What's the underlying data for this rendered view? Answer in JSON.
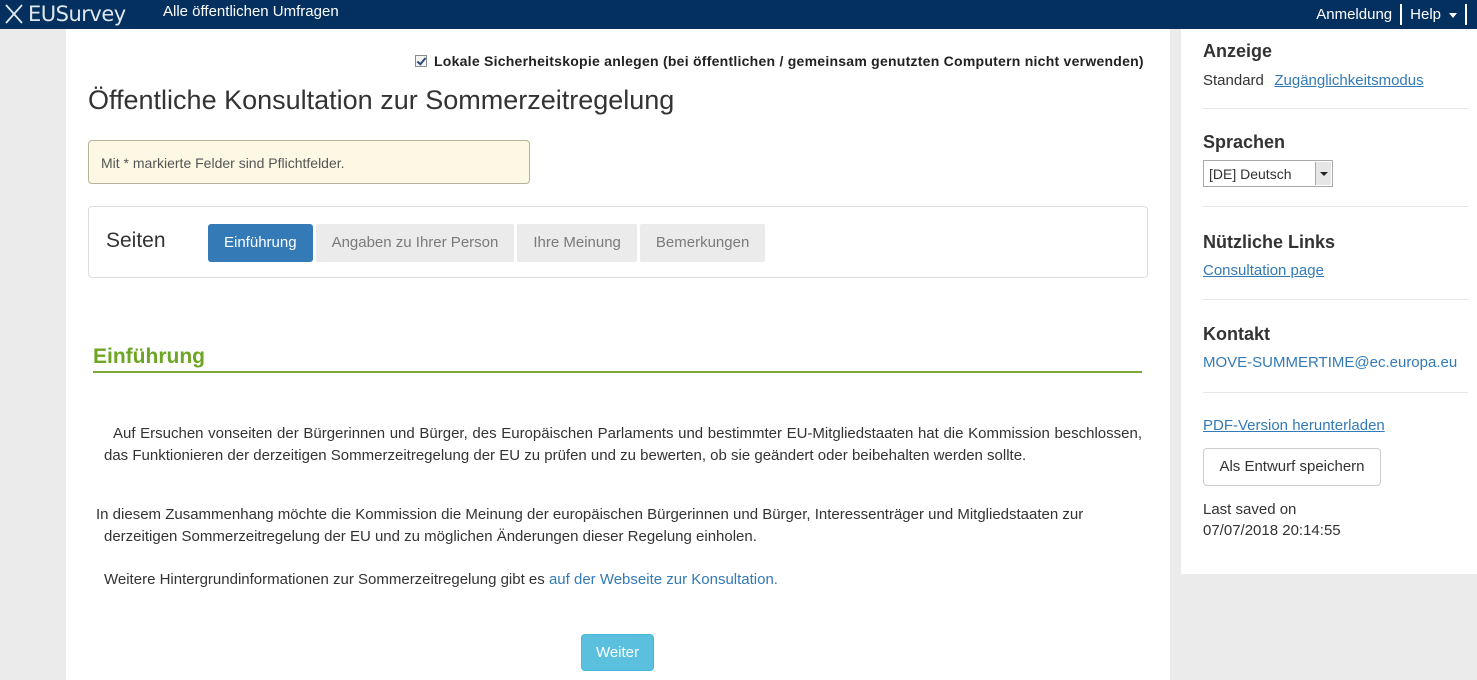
{
  "topbar": {
    "logo_text": "EUSurvey",
    "public_surveys": "Alle öffentlichen Umfragen",
    "login": "Anmeldung",
    "help": "Help"
  },
  "main": {
    "backup_label": "Lokale Sicherheitskopie anlegen (bei öffentlichen / gemeinsam genutzten Computern nicht verwenden)",
    "backup_checked": true,
    "title": "Öffentliche Konsultation zur Sommerzeitregelung",
    "required_notice": "Mit * markierte Felder sind Pflichtfelder.",
    "pages_label": "Seiten",
    "tabs": [
      {
        "label": "Einführung",
        "active": true
      },
      {
        "label": "Angaben zu Ihrer Person",
        "active": false
      },
      {
        "label": "Ihre Meinung",
        "active": false
      },
      {
        "label": "Bemerkungen",
        "active": false
      }
    ],
    "section_title": "Einführung",
    "para1": "Auf Ersuchen vonseiten der Bürgerinnen und Bürger, des Europäischen Parlaments und bestimmter EU-Mitgliedstaaten hat die Kommission beschlossen, das Funktionieren der derzeitigen Sommerzeitregelung der EU zu prüfen und zu bewerten, ob sie geändert oder beibehalten werden sollte.",
    "para2_line1": "In diesem Zusammenhang möchte die Kommission die Meinung der europäischen Bürgerinnen und Bürger, Interessenträger und Mitgliedstaaten zur",
    "para2_line2": "derzeitigen Sommerzeitregelung der EU und zu möglichen Änderungen dieser Regelung einholen.",
    "para3_text": "Weitere Hintergrundinformationen zur Sommerzeitregelung gibt es ",
    "para3_link": "auf der Webseite zur Konsultation.",
    "next_button": "Weiter"
  },
  "sidebar": {
    "display_heading": "Anzeige",
    "display_standard": "Standard",
    "display_accessibility": "Zugänglichkeitsmodus",
    "languages_heading": "Sprachen",
    "language_selected": "[DE] Deutsch",
    "links_heading": "Nützliche Links",
    "consultation_link": "Consultation page",
    "contact_heading": "Kontakt",
    "contact_email": "MOVE-SUMMERTIME@ec.europa.eu",
    "pdf_link": "PDF-Version herunterladen",
    "draft_button": "Als Entwurf speichern",
    "last_saved_label": "Last saved on",
    "last_saved_value": "07/07/2018 20:14:55"
  },
  "colors": {
    "topbar": "#03305e",
    "active_tab": "#337ab7",
    "section_green": "#6ea524",
    "next_button": "#5bc0de",
    "notice_bg": "#fcf8e3"
  }
}
